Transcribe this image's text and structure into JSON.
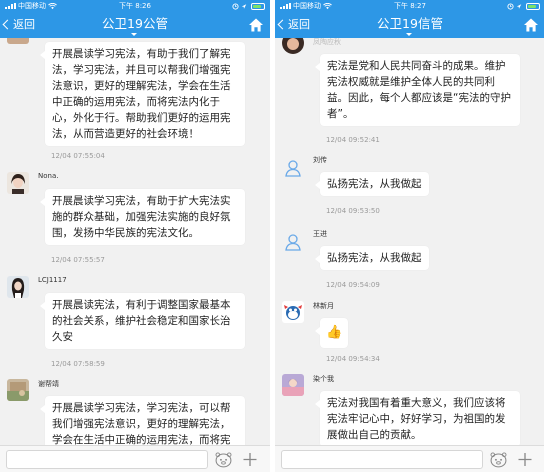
{
  "screens": [
    {
      "status": {
        "carrier": "中国移动",
        "time": "下午 8:26"
      },
      "nav": {
        "back_label": "返回",
        "title": "公卫19公管"
      },
      "messages": [
        {
          "sender": "",
          "text": "开展晨读学习宪法，有助于我们了解宪法，学习宪法，并且可以帮我们增强宪法意识，更好的理解宪法，学会在生活中正确的运用宪法，而将宪法内化于心，外化于行。帮助我们更好的运用宪法，从而营造更好的社会环境！",
          "time": "12/04 07:55:04"
        },
        {
          "sender": "Nona.",
          "text": "开展晨读学习宪法，有助于扩大宪法实施的群众基础，加强宪法实施的良好氛围，发扬中华民族的宪法文化。",
          "time": "12/04 07:55:57"
        },
        {
          "sender": "LCJ1117",
          "text": "开展晨读宪法，有利于调整国家最基本的社会关系，维护社会稳定和国家长治久安",
          "time": "12/04 07:58:59"
        },
        {
          "sender": "谢帮靖",
          "text": "开展晨读学习宪法，学习宪法，可以帮我们增强宪法意识，更好的理解宪法，学会在生活中正确的运用宪法，而将宪",
          "time": ""
        }
      ]
    },
    {
      "status": {
        "carrier": "中国移动",
        "time": "下午 8:27"
      },
      "nav": {
        "back_label": "返回",
        "title": "公卫19信管"
      },
      "messages": [
        {
          "sender": "凤陶应秋",
          "text": "宪法是党和人民共同奋斗的成果。维护宪法权威就是维护全体人民的共同利益。因此，每个人都应该是“宪法的守护者”。",
          "time": "12/04 09:52:41"
        },
        {
          "sender": "刘传",
          "text": "弘扬宪法，从我做起",
          "time": "12/04 09:53:50"
        },
        {
          "sender": "王进",
          "text": "弘扬宪法，从我做起",
          "time": "12/04 09:54:09"
        },
        {
          "sender": "林新月",
          "text": "👍",
          "time": "12/04 09:54:34"
        },
        {
          "sender": "染个我",
          "text": "宪法对我国有着重大意义，我们应该将宪法牢记心中，好好学习，为祖国的发展做出自己的贡献。",
          "time": ""
        }
      ]
    }
  ],
  "colors": {
    "nav_bg": "#2d97e6",
    "chat_bg": "#f1f1f1",
    "bubble_bg": "#ffffff",
    "timestamp": "#9a9a9a",
    "default_avatar": "#6aa9e8"
  },
  "icons": [
    "wifi-icon",
    "alarm-icon",
    "location-icon",
    "battery-icon",
    "chevron-left-icon",
    "home-icon",
    "emoji-icon",
    "plus-icon",
    "default-user-icon"
  ]
}
